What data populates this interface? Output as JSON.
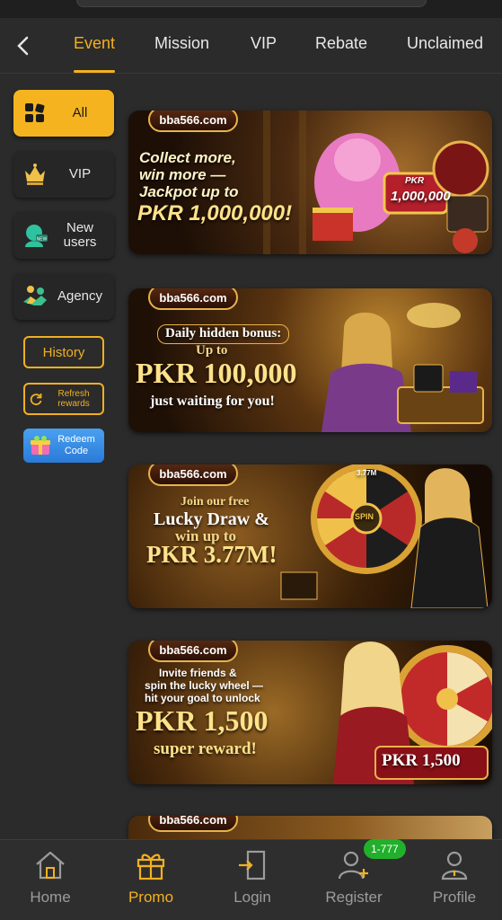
{
  "tabs": [
    {
      "label": "Event",
      "active": true
    },
    {
      "label": "Mission",
      "active": false
    },
    {
      "label": "VIP",
      "active": false
    },
    {
      "label": "Rebate",
      "active": false
    },
    {
      "label": "Unclaimed",
      "active": false
    }
  ],
  "sidebar": {
    "categories": [
      {
        "label": "All",
        "icon": "grid-icon",
        "active": true
      },
      {
        "label": "VIP",
        "icon": "crown-icon",
        "active": false
      },
      {
        "label": "New users",
        "icon": "new-user-icon",
        "active": false
      },
      {
        "label": "Agency",
        "icon": "handshake-icon",
        "active": false
      }
    ],
    "history_label": "History",
    "refresh_label": "Refresh rewards",
    "redeem_label": "Redeem Code"
  },
  "banners": [
    {
      "logo": "bba566.com",
      "lines": [
        "Collect more,",
        "win more —",
        "Jackpot up to",
        "PKR 1,000,000!"
      ],
      "sign_top": "PKR",
      "sign_bottom": "1,000,000"
    },
    {
      "logo": "bba566.com",
      "lines": [
        "Daily hidden bonus:",
        "Up to",
        "PKR 100,000",
        "just waiting for you!"
      ]
    },
    {
      "logo": "bba566.com",
      "lines": [
        "Join our free",
        "Lucky Draw &",
        "win up to",
        "PKR 3.77M!"
      ],
      "wheel_center": "SPIN",
      "wheel_top": "3.77M"
    },
    {
      "logo": "bba566.com",
      "lines": [
        "Invite friends &",
        "spin the lucky wheel —",
        "hit your goal to unlock",
        "PKR 1,500",
        "super reward!"
      ],
      "sign": "PKR 1,500"
    },
    {
      "logo": "bba566.com"
    }
  ],
  "bottom_nav": [
    {
      "label": "Home",
      "icon": "home-icon",
      "active": false
    },
    {
      "label": "Promo",
      "icon": "gift-icon",
      "active": true
    },
    {
      "label": "Login",
      "icon": "login-icon",
      "active": false
    },
    {
      "label": "Register",
      "icon": "register-icon",
      "active": false
    },
    {
      "label": "Profile",
      "icon": "profile-icon",
      "active": false
    }
  ],
  "register_badge": "1-777",
  "colors": {
    "accent": "#f4b11f",
    "background": "#2b2b2b",
    "badge": "#21b02b",
    "redeem": "#2a7bd8"
  }
}
